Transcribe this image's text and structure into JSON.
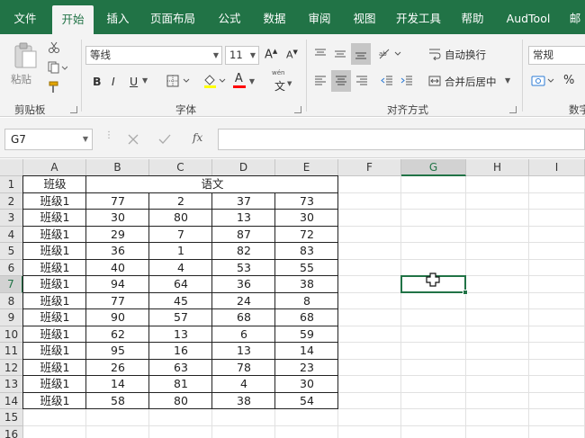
{
  "ribbon_tabs": [
    "文件",
    "开始",
    "插入",
    "页面布局",
    "公式",
    "数据",
    "审阅",
    "视图",
    "开发工具",
    "帮助",
    "AudTool",
    "邮"
  ],
  "active_tab": "开始",
  "clipboard": {
    "paste_label": "粘贴",
    "group_label": "剪贴板"
  },
  "font": {
    "name": "等线",
    "size": "11",
    "grow_label": "A",
    "shrink_label": "A",
    "bold": "B",
    "italic": "I",
    "underline": "U",
    "color_label": "A",
    "group_label": "字体",
    "wen_label": "文"
  },
  "alignment": {
    "wrap_label": "自动换行",
    "merge_label": "合并后居中",
    "group_label": "对齐方式"
  },
  "number": {
    "format": "常规",
    "percent": "%",
    "group_label": "数字"
  },
  "formula_bar": {
    "cell_ref": "G7",
    "fx_label": "fx",
    "value": ""
  },
  "colors": {
    "accent": "#217346",
    "tab_text": "#ffffff"
  },
  "grid": {
    "columns": [
      "A",
      "B",
      "C",
      "D",
      "E",
      "F",
      "G",
      "H",
      "I"
    ],
    "selected_column": "G",
    "rows": [
      "1",
      "2",
      "3",
      "4",
      "5",
      "6",
      "7",
      "8",
      "9",
      "10",
      "11",
      "12",
      "13",
      "14",
      "15",
      "16"
    ],
    "selected_row": "7",
    "header_row": {
      "a": "班级",
      "merged": "语文"
    },
    "data": [
      [
        "班级1",
        "77",
        "2",
        "37",
        "73"
      ],
      [
        "班级1",
        "30",
        "80",
        "13",
        "30"
      ],
      [
        "班级1",
        "29",
        "7",
        "87",
        "72"
      ],
      [
        "班级1",
        "36",
        "1",
        "82",
        "83"
      ],
      [
        "班级1",
        "40",
        "4",
        "53",
        "55"
      ],
      [
        "班级1",
        "94",
        "64",
        "36",
        "38"
      ],
      [
        "班级1",
        "77",
        "45",
        "24",
        "8"
      ],
      [
        "班级1",
        "90",
        "57",
        "68",
        "68"
      ],
      [
        "班级1",
        "62",
        "13",
        "6",
        "59"
      ],
      [
        "班级1",
        "95",
        "16",
        "13",
        "14"
      ],
      [
        "班级1",
        "26",
        "63",
        "78",
        "23"
      ],
      [
        "班级1",
        "14",
        "81",
        "4",
        "30"
      ],
      [
        "班级1",
        "58",
        "80",
        "38",
        "54"
      ]
    ]
  }
}
